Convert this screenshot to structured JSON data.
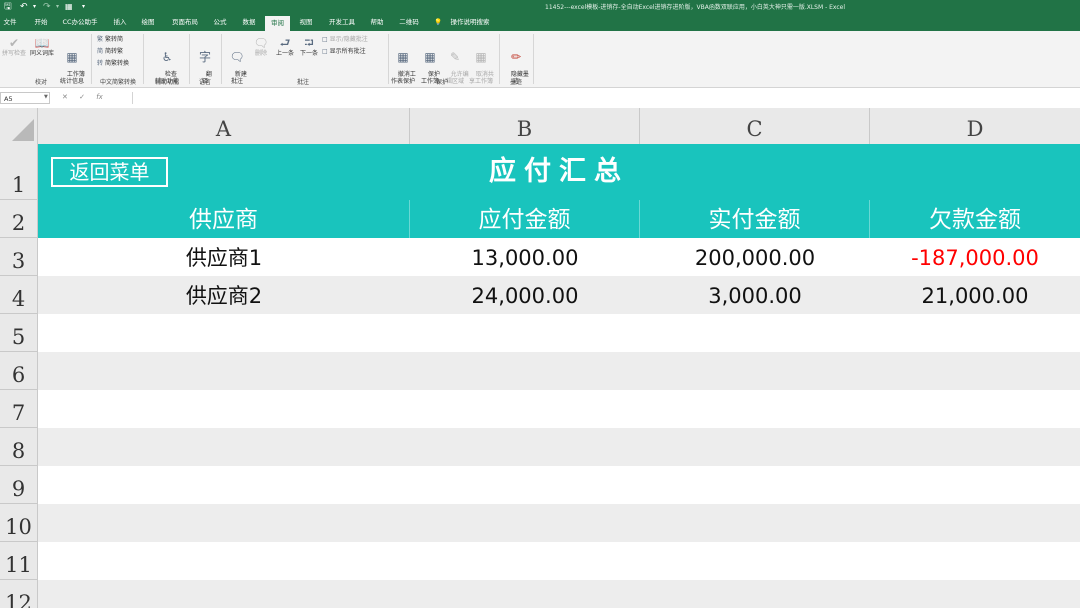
{
  "window": {
    "title": "11452---excel模板-进销存-全自动Excel进销存进阶版，VBA函数双联应用，小白英大神只需一版.XLSM  -  Excel"
  },
  "ribbon_tabs": [
    {
      "label": "文件"
    },
    {
      "label": "开始"
    },
    {
      "label": "CC办公助手"
    },
    {
      "label": "插入"
    },
    {
      "label": "绘图"
    },
    {
      "label": "页面布局"
    },
    {
      "label": "公式"
    },
    {
      "label": "数据"
    },
    {
      "label": "审阅",
      "active": true
    },
    {
      "label": "视图"
    },
    {
      "label": "开发工具"
    },
    {
      "label": "帮助"
    },
    {
      "label": "二维码"
    },
    {
      "label": "操作说明搜索"
    }
  ],
  "ribbon": {
    "proofing": {
      "spelling": "拼写检查",
      "thesaurus": "同义词库",
      "workbook_stats": "工作簿\n统计信息",
      "group": "校对"
    },
    "chinese": {
      "to_simplified": "繁转简",
      "to_traditional": "简转繁",
      "convert": "简繁转换",
      "group": "中文简繁转换"
    },
    "accessibility": {
      "check": "检查\n辅助功能",
      "group": "辅助功能"
    },
    "language": {
      "translate": "翻\n译",
      "group": "语言"
    },
    "comments": {
      "new": "新建\n批注",
      "delete": "删除",
      "previous": "上一条",
      "next": "下一条",
      "show_hide": "显示/隐藏批注",
      "show_all": "显示所有批注",
      "group": "批注"
    },
    "protect": {
      "unprotect_sheet": "撤消工\n作表保护",
      "protect_workbook": "保护\n工作簿",
      "allow_edit": "允许编\n辑区域",
      "unshare": "取消共\n享工作簿",
      "group": "保护"
    },
    "ink": {
      "hide_ink": "隐藏墨\n迹",
      "group": "墨迹"
    }
  },
  "formula_bar": {
    "name_box": "A5",
    "cancel": "✕",
    "enter": "✓",
    "fx": "fx",
    "value": ""
  },
  "column_headers": [
    "A",
    "B",
    "C",
    "D"
  ],
  "row_headers": [
    "1",
    "2",
    "3",
    "4",
    "5",
    "6",
    "7",
    "8",
    "9",
    "10",
    "11",
    "12"
  ],
  "sheet": {
    "back_button": "返回菜单",
    "title": "应付汇总",
    "headers": [
      "供应商",
      "应付金额",
      "实付金额",
      "欠款金额"
    ],
    "rows": [
      [
        "供应商1",
        "13,000.00",
        "200,000.00",
        "-187,000.00"
      ],
      [
        "供应商2",
        "24,000.00",
        "3,000.00",
        "21,000.00"
      ]
    ]
  },
  "colors": {
    "excel_green": "#217346",
    "table_teal": "#19c4bd",
    "negative_red": "#ff0000",
    "stripe_gray": "#ededed"
  }
}
